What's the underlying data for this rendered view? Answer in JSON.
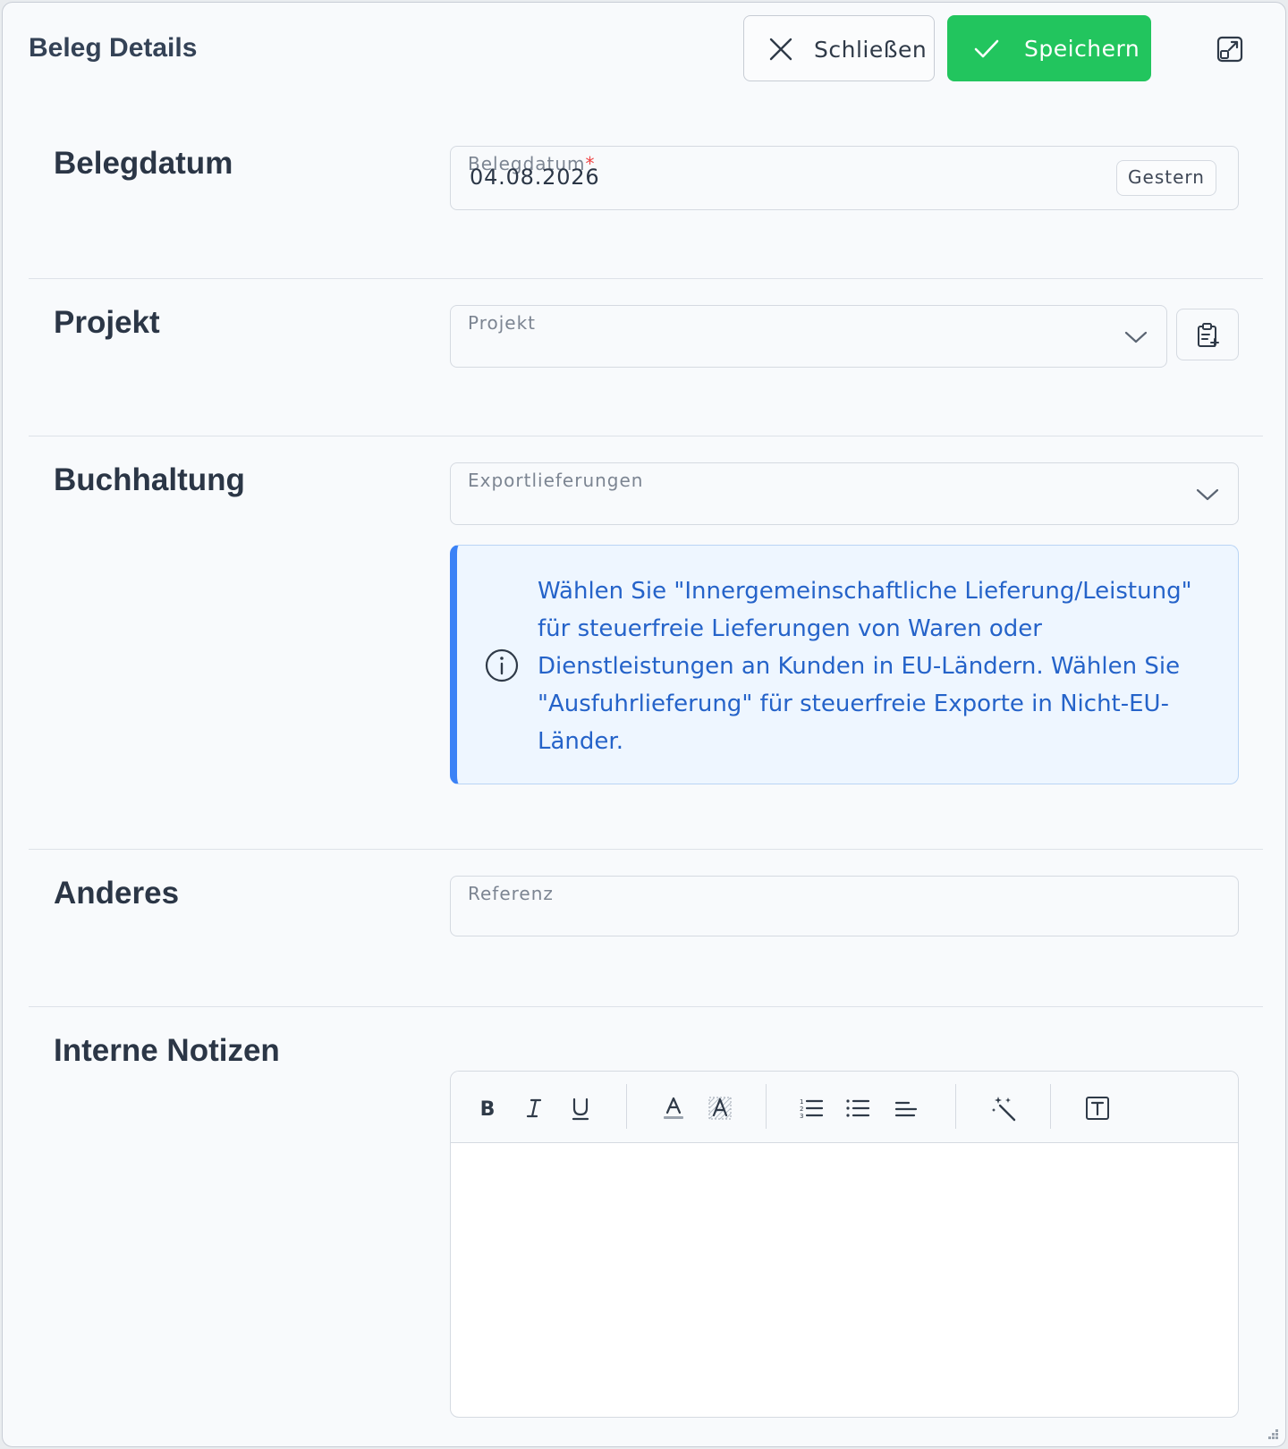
{
  "header": {
    "title": "Beleg Details",
    "close_label": "Schließen",
    "save_label": "Speichern"
  },
  "sections": {
    "belegdatum": {
      "label": "Belegdatum",
      "field_label": "Belegdatum",
      "required_mark": "*",
      "value": "04.08.2026",
      "shortcut_label": "Gestern"
    },
    "projekt": {
      "label": "Projekt",
      "field_label": "Projekt",
      "value": ""
    },
    "buchhaltung": {
      "label": "Buchhaltung",
      "field_label": "Exportlieferungen",
      "value": "",
      "info_text": "Wählen Sie \"Innergemeinschaftliche Lieferung/Leistung\" für steuerfreie Lieferungen von Waren oder Dienstleistungen an Kunden in EU-Ländern. Wählen Sie \"Ausfuhrlieferung\" für steuerfreie Exporte in Nicht-EU-Länder."
    },
    "anderes": {
      "label": "Anderes",
      "field_label": "Referenz",
      "value": ""
    },
    "notizen": {
      "label": "Interne Notizen",
      "content": ""
    }
  },
  "colors": {
    "accent_green": "#22c55e",
    "info_blue": "#2563c9",
    "info_border": "#3b82f6",
    "required_red": "#ef4444"
  },
  "icons": {
    "close": "close-icon",
    "save": "check-icon",
    "expand": "expand-icon",
    "chevron": "chevron-down-icon",
    "clipboard": "clipboard-add-icon",
    "info": "info-icon",
    "toolbar": [
      "bold-icon",
      "italic-icon",
      "underline-icon",
      "text-color-icon",
      "highlight-icon",
      "ordered-list-icon",
      "bullet-list-icon",
      "align-left-icon",
      "magic-wand-icon",
      "text-box-icon"
    ]
  }
}
